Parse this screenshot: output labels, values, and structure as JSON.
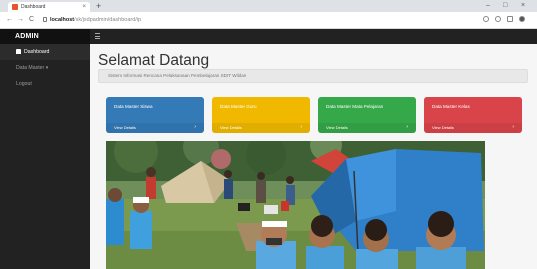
{
  "browser": {
    "tab_title": "Dashboard",
    "tab_close": "×",
    "new_tab": "+",
    "url_host": "localhost",
    "url_path": "/sk/jsdpadmin/dashboard/ip",
    "window_min": "–",
    "window_max": "□",
    "window_close": "×",
    "back": "←",
    "forward": "→",
    "reload": "C",
    "home": "⌂"
  },
  "app": {
    "brand": "ADMIN",
    "sidebar": {
      "items": [
        {
          "label": "Dashboard"
        },
        {
          "label": "Data Master ▾"
        },
        {
          "label": "Logout"
        }
      ]
    },
    "main": {
      "title": "Selamat Datang",
      "subtitle": "Sistem Informasi Rencana Pelaksanaan Pembelajaran SDIT Wildan"
    },
    "cards": [
      {
        "title": "Data Master Siswa",
        "footer": "View Details",
        "arrow": "›",
        "color": "#337ab7"
      },
      {
        "title": "Data Master Guru",
        "footer": "View Details",
        "arrow": "›",
        "color": "#f0b900"
      },
      {
        "title": "Data Master Mata Pelajaran",
        "footer": "View Details",
        "arrow": "›",
        "color": "#35a84a"
      },
      {
        "title": "Data Master Kelas",
        "footer": "View Details",
        "arrow": "›",
        "color": "#d9434a"
      }
    ]
  },
  "icons": [
    "home-icon",
    "hamburger-icon",
    "chevron-right-icon",
    "lock-icon"
  ]
}
